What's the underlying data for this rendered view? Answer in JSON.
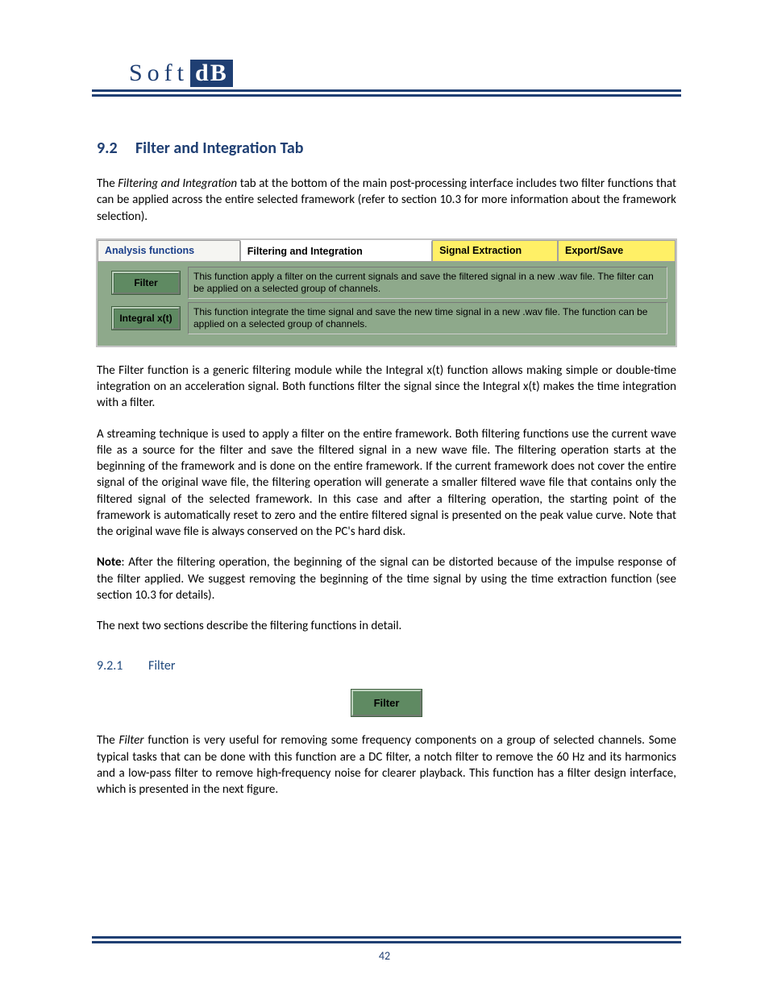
{
  "logo": {
    "left": "Soft",
    "right": "dB"
  },
  "section": {
    "num": "9.2",
    "title": "Filter and Integration Tab"
  },
  "para1_a": "The ",
  "para1_em": "Filtering and Integration",
  "para1_b": " tab at the bottom of the main post-processing interface includes two filter functions that can be applied across the entire selected framework (refer to section 10.3 for more information about the framework selection).",
  "tabs": {
    "analysis": "Analysis functions",
    "filtering": "Filtering and Integration",
    "signal": "Signal Extraction",
    "export": "Export/Save"
  },
  "fn1": {
    "label": "Filter",
    "desc": "This function apply a filter on the current signals and save the filtered signal in a new .wav file. The filter can be applied on a selected group of channels."
  },
  "fn2": {
    "label": "Integral x(t)",
    "desc": "This function integrate the time signal and save the new time signal in a new .wav file. The function can be applied on a selected group of channels."
  },
  "para2": "The Filter function is a generic filtering module while the Integral x(t) function allows making simple or double-time integration on an acceleration signal. Both functions filter the signal since the Integral x(t) makes the time integration with a filter.",
  "para3": "A streaming technique is used to apply a filter on the entire framework. Both filtering functions use the current wave file as a source for the filter and save the filtered signal in a new wave file. The filtering operation starts at the beginning of the framework and is done on the entire framework. If the current framework does not cover the entire signal of the original wave file, the filtering operation will generate a smaller filtered wave file that contains only the filtered signal of the selected framework. In this case and after a filtering operation, the starting point of the framework is automatically reset to zero and the entire filtered signal is presented on the peak value curve. Note that the original wave file is always conserved on the PC's hard disk.",
  "note_label": "Note",
  "para4": ": After the filtering operation, the beginning of the signal can be distorted because of the impulse response of the filter applied. We suggest removing the beginning of the time signal by using the time extraction function (see section 10.3 for details).",
  "para5": "The next two sections describe the filtering functions in detail.",
  "sub": {
    "num": "9.2.1",
    "title": "Filter"
  },
  "inline_btn": "Filter",
  "para6_a": "The ",
  "para6_em": "Filter",
  "para6_b": " function is very useful for removing some frequency components on a group of selected channels. Some typical tasks that can be done with this function are a DC filter, a notch filter to remove the 60 Hz and its harmonics and a low-pass filter to remove high-frequency noise for clearer playback. This function has a filter design interface, which is presented in the next figure.",
  "page_number": "42"
}
